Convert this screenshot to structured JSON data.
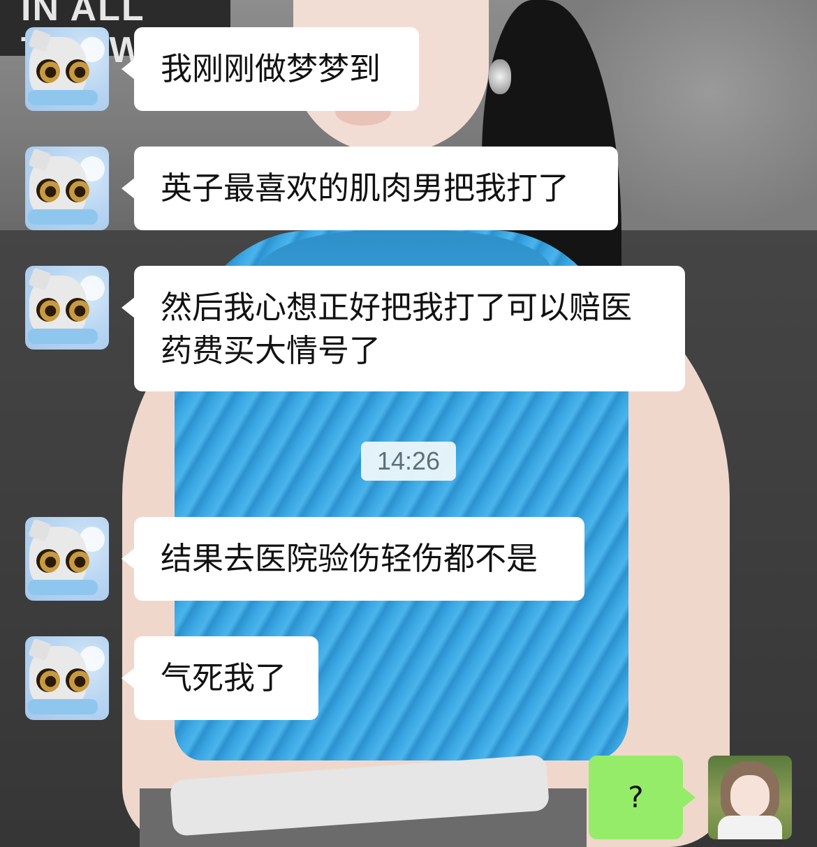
{
  "background": {
    "banner_text": "IN ALL THE W"
  },
  "chat": {
    "messages": [
      {
        "sender": "other",
        "lines": [
          "我刚刚做梦梦到"
        ]
      },
      {
        "sender": "other",
        "lines": [
          "英子最喜欢的肌肉男把我打了"
        ]
      },
      {
        "sender": "other",
        "lines": [
          "然后我心想正好把我打了可以赔医",
          "药费买大情号了"
        ]
      },
      {
        "sender": "other",
        "lines": [
          "结果去医院验伤轻伤都不是"
        ]
      },
      {
        "sender": "other",
        "lines": [
          "气死我了"
        ]
      }
    ],
    "timestamp": "14:26",
    "self_message": "?"
  },
  "colors": {
    "bubble_other": "#ffffff",
    "bubble_self": "#95ec69",
    "timestamp_bg": "#eaf6fa",
    "timestamp_text": "#5c6f7a"
  }
}
